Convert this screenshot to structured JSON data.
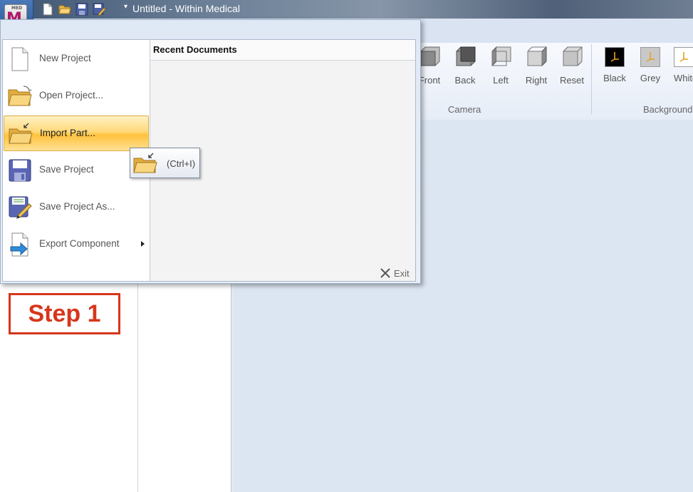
{
  "window": {
    "title": "Untitled - Within Medical",
    "app_button_icon": "app-logo-icon",
    "quick_access": [
      "new-doc-icon",
      "open-folder-icon",
      "save-icon",
      "save-as-icon"
    ]
  },
  "ribbon": {
    "camera_group": {
      "label": "Camera",
      "buttons": [
        {
          "label": "Front",
          "icon": "cube-front-icon"
        },
        {
          "label": "Back",
          "icon": "cube-back-icon"
        },
        {
          "label": "Left",
          "icon": "cube-left-icon"
        },
        {
          "label": "Right",
          "icon": "cube-right-icon"
        },
        {
          "label": "Reset",
          "icon": "cube-reset-icon"
        }
      ]
    },
    "background_group": {
      "label": "Background",
      "buttons": [
        {
          "label": "Black",
          "icon": "bg-black-icon",
          "color": "#000000"
        },
        {
          "label": "Grey",
          "icon": "bg-grey-icon",
          "color": "#c8c8c8"
        },
        {
          "label": "White",
          "icon": "bg-white-icon",
          "color": "#ffffff"
        }
      ]
    }
  },
  "app_menu": {
    "commands": [
      {
        "label": "New Project",
        "icon": "new-project-icon",
        "highlighted": false
      },
      {
        "label": "Open Project...",
        "icon": "open-project-icon",
        "highlighted": false
      },
      {
        "label": "Import Part...",
        "icon": "import-part-icon",
        "highlighted": true
      },
      {
        "label": "Save Project",
        "icon": "save-project-icon",
        "highlighted": false
      },
      {
        "label": "Save Project As...",
        "icon": "save-project-as-icon",
        "highlighted": false
      },
      {
        "label": "Export Component",
        "icon": "export-component-icon",
        "highlighted": false,
        "has_submenu": true
      }
    ],
    "recent_documents_header": "Recent Documents",
    "recent_documents": [],
    "exit_label": "Exit"
  },
  "tooltip": {
    "shortcut": "(Ctrl+I)",
    "icon": "import-part-icon"
  },
  "annotation": {
    "step_label": "Step 1",
    "color": "#d6361b"
  },
  "colors": {
    "highlight": "#ffc23d",
    "viewport": "#dce5f2"
  }
}
